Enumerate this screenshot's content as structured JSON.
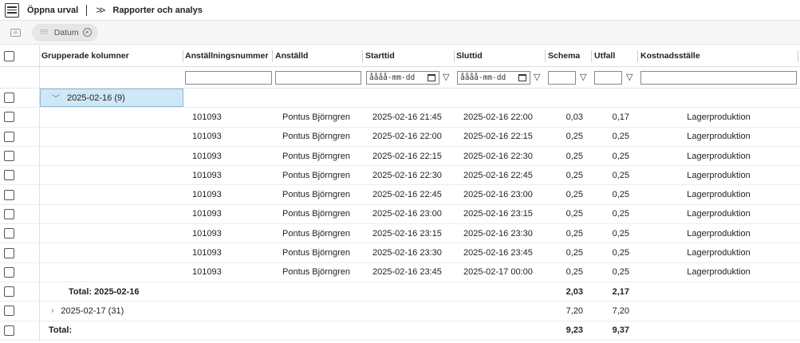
{
  "toolbar": {
    "open_selection": "Öppna urval",
    "reports": "Rapporter och analys"
  },
  "groupbar": {
    "chip_label": "Datum"
  },
  "columns": {
    "grouped": "Grupperade kolumner",
    "emp_no": "Anställningsnummer",
    "employee": "Anställd",
    "start": "Starttid",
    "end": "Sluttid",
    "schema": "Schema",
    "utfall": "Utfall",
    "cost": "Kostnadsställe"
  },
  "filters": {
    "date_placeholder": "åååå-mm-dd"
  },
  "group1": {
    "label": "2025-02-16 (9)",
    "rows": [
      {
        "emp": "101093",
        "name": "Pontus Björngren",
        "start": "2025-02-16 21:45",
        "end": "2025-02-16 22:00",
        "schema": "0,03",
        "utfall": "0,17",
        "cost": "Lagerproduktion"
      },
      {
        "emp": "101093",
        "name": "Pontus Björngren",
        "start": "2025-02-16 22:00",
        "end": "2025-02-16 22:15",
        "schema": "0,25",
        "utfall": "0,25",
        "cost": "Lagerproduktion"
      },
      {
        "emp": "101093",
        "name": "Pontus Björngren",
        "start": "2025-02-16 22:15",
        "end": "2025-02-16 22:30",
        "schema": "0,25",
        "utfall": "0,25",
        "cost": "Lagerproduktion"
      },
      {
        "emp": "101093",
        "name": "Pontus Björngren",
        "start": "2025-02-16 22:30",
        "end": "2025-02-16 22:45",
        "schema": "0,25",
        "utfall": "0,25",
        "cost": "Lagerproduktion"
      },
      {
        "emp": "101093",
        "name": "Pontus Björngren",
        "start": "2025-02-16 22:45",
        "end": "2025-02-16 23:00",
        "schema": "0,25",
        "utfall": "0,25",
        "cost": "Lagerproduktion"
      },
      {
        "emp": "101093",
        "name": "Pontus Björngren",
        "start": "2025-02-16 23:00",
        "end": "2025-02-16 23:15",
        "schema": "0,25",
        "utfall": "0,25",
        "cost": "Lagerproduktion"
      },
      {
        "emp": "101093",
        "name": "Pontus Björngren",
        "start": "2025-02-16 23:15",
        "end": "2025-02-16 23:30",
        "schema": "0,25",
        "utfall": "0,25",
        "cost": "Lagerproduktion"
      },
      {
        "emp": "101093",
        "name": "Pontus Björngren",
        "start": "2025-02-16 23:30",
        "end": "2025-02-16 23:45",
        "schema": "0,25",
        "utfall": "0,25",
        "cost": "Lagerproduktion"
      },
      {
        "emp": "101093",
        "name": "Pontus Björngren",
        "start": "2025-02-16 23:45",
        "end": "2025-02-17 00:00",
        "schema": "0,25",
        "utfall": "0,25",
        "cost": "Lagerproduktion"
      }
    ],
    "total_label": "Total: 2025-02-16",
    "total_schema": "2,03",
    "total_utfall": "2,17"
  },
  "group2": {
    "label": "2025-02-17 (31)",
    "schema": "7,20",
    "utfall": "7,20"
  },
  "grand_total": {
    "label": "Total:",
    "schema": "9,23",
    "utfall": "9,37"
  }
}
